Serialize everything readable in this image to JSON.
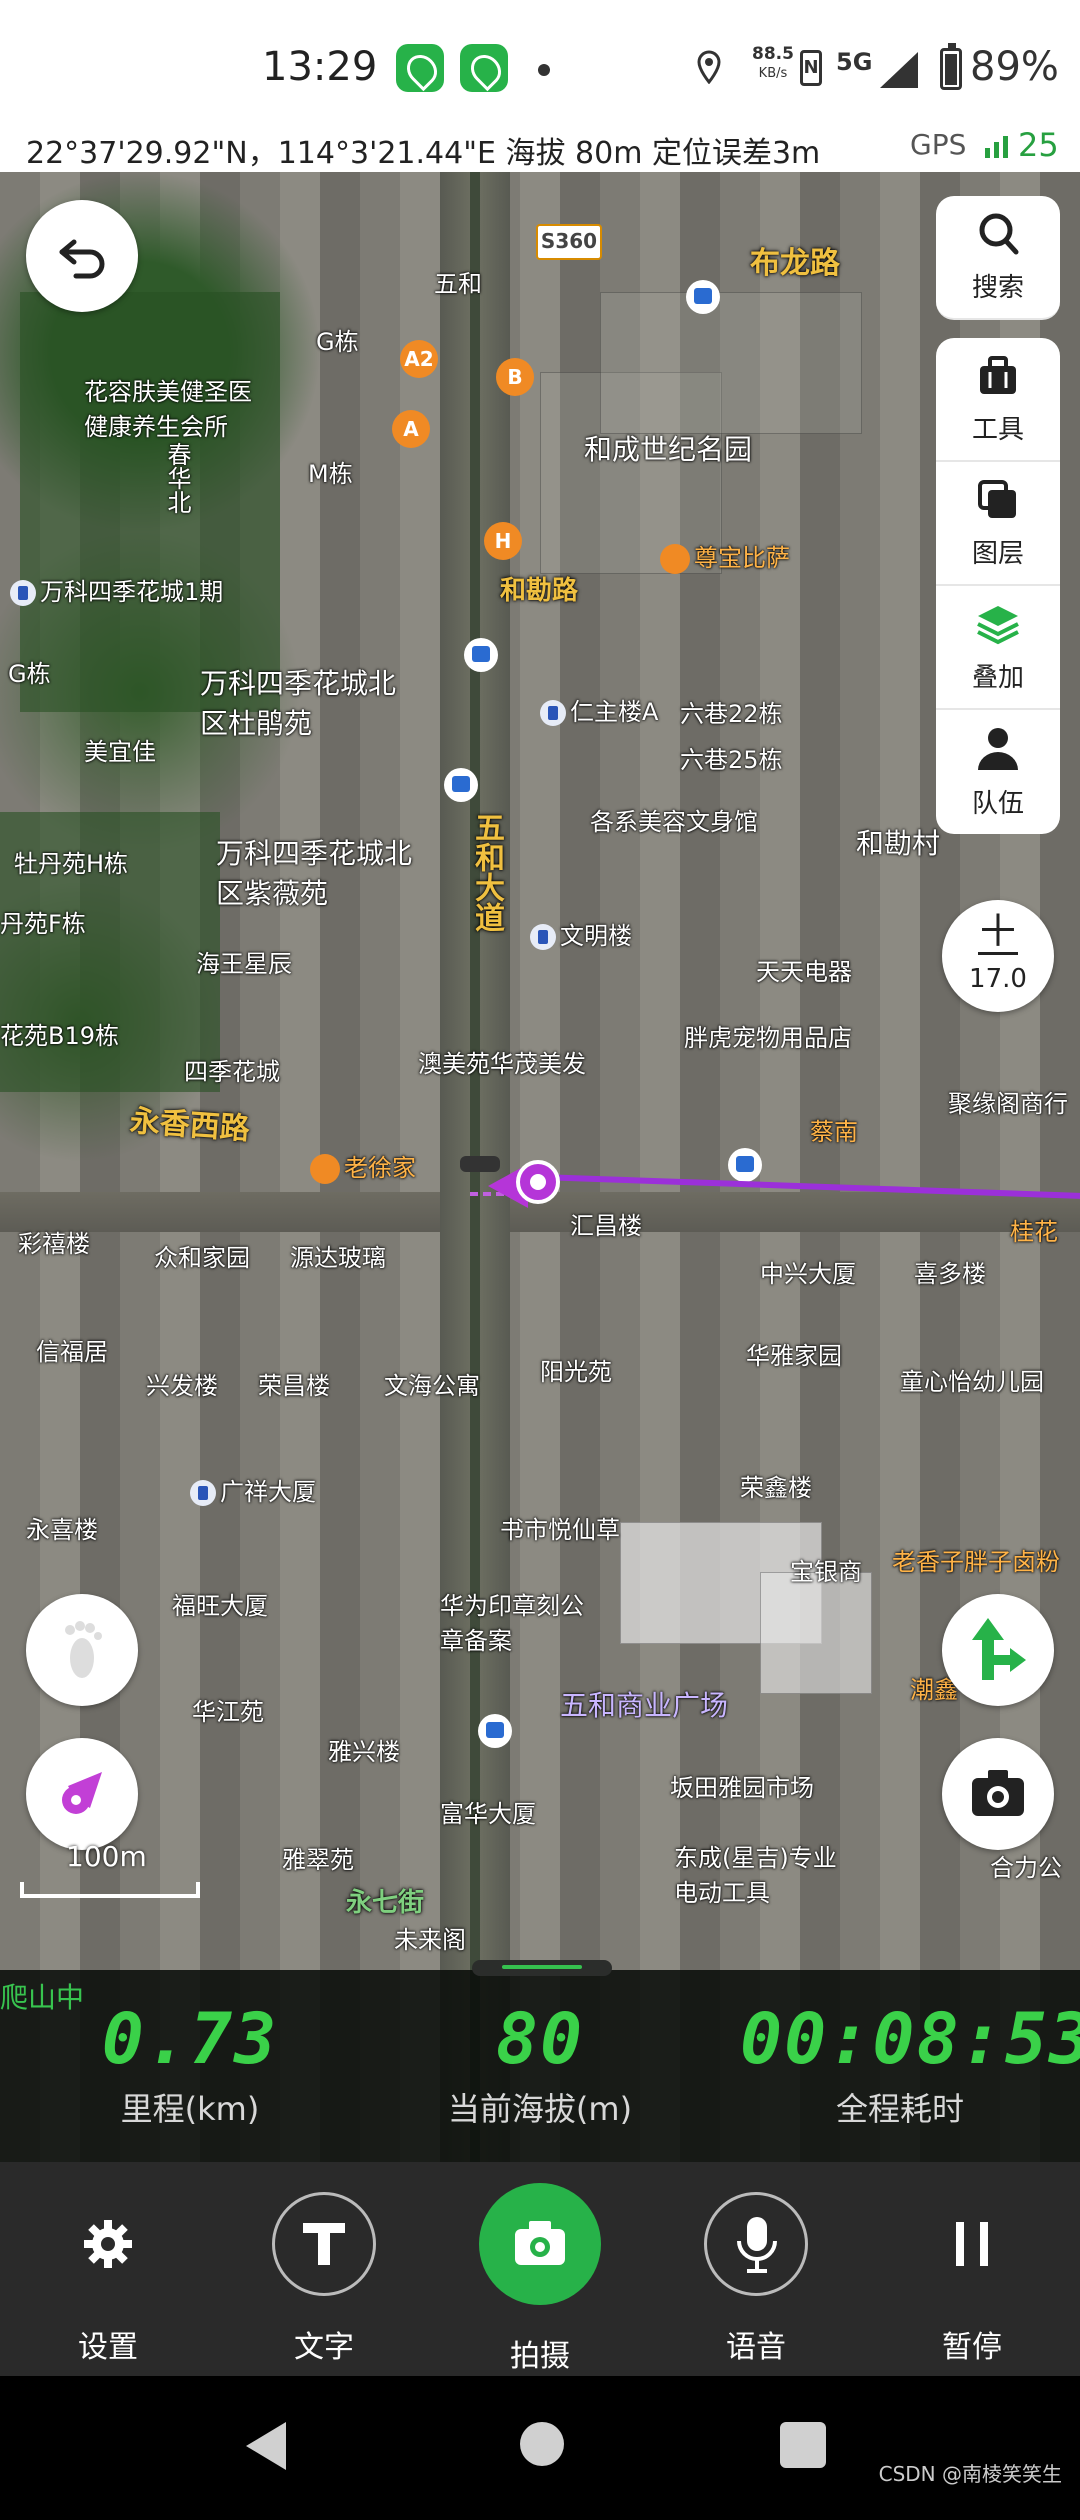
{
  "status_bar": {
    "time": "13:29",
    "network_speed_value": "88.5",
    "network_speed_unit": "KB/s",
    "network_type": "5G",
    "battery": "89%"
  },
  "location_bar": {
    "coordinates": "22°37'29.92\"N，114°3'21.44\"E  海拔 80m  定位误差3m",
    "gps_label": "GPS",
    "satellite_count": "25"
  },
  "map": {
    "route_shield": "S360",
    "road_labels": [
      "布龙路",
      "五和大道",
      "永香西路",
      "和勘路",
      "永七街"
    ],
    "pois": [
      "五和",
      "G栋",
      "花容肤美健圣医健康养生会所",
      "春华北",
      "和成世纪名园",
      "M栋",
      "尊宝比萨",
      "万科四季花城1期",
      "美宜佳",
      "G栋",
      "万科四季花城北区杜鹃苑",
      "仁主楼A",
      "六巷22栋",
      "六巷25栋",
      "各系美容文身馆",
      "和勘村",
      "牡丹苑H栋",
      "丹苑F栋",
      "万科四季花城北区紫薇苑",
      "文明楼",
      "海王星辰",
      "天天电器",
      "花苑B19栋",
      "四季花城",
      "澳美苑华茂美发",
      "胖虎宠物用品店",
      "聚缘阁商行",
      "老徐家",
      "汇昌楼",
      "蔡南",
      "桂花",
      "彩禧楼",
      "众和家园",
      "源达玻璃",
      "中兴大厦",
      "喜多楼",
      "信福居",
      "兴发楼",
      "荣昌楼",
      "文海公寓",
      "阳光苑",
      "华雅家园",
      "童心怡幼儿园",
      "永喜楼",
      "广祥大厦",
      "荣鑫楼",
      "书市悦仙草",
      "老香子胖子卤粉",
      "福旺大厦",
      "华为印章刻公章备案",
      "宝银商",
      "潮鑫",
      "华江苑",
      "雅兴楼",
      "五和商业广场",
      "坂田雅园市场",
      "富华大厦",
      "东成(星吉)专业电动工具",
      "雅翠苑",
      "未来阁",
      "合力公"
    ],
    "exits": [
      "A2",
      "B",
      "A",
      "H"
    ],
    "zoom_level": "17.0",
    "scale_label": "100m"
  },
  "side_panel": {
    "search": "搜索",
    "tools": "工具",
    "layers": "图层",
    "overlay": "叠加",
    "team": "队伍"
  },
  "stats": {
    "status": "爬山中",
    "distance_value": "0.73",
    "distance_label": "里程(km)",
    "altitude_value": "80",
    "altitude_label": "当前海拔(m)",
    "elapsed_value": "00:08:53",
    "elapsed_label": "全程耗时"
  },
  "toolbar": {
    "settings": "设置",
    "text": "文字",
    "photo": "拍摄",
    "voice": "语音",
    "pause": "暂停"
  },
  "watermark": "CSDN @南棱笑笑生",
  "colors": {
    "accent_green": "#27b249",
    "stat_green": "#3ad149",
    "route_purple": "#9b30d9"
  },
  "icons": {
    "back": "back-arrow-icon",
    "search": "search-icon",
    "tools": "toolbox-icon",
    "layers": "layers-icon",
    "overlay": "stack-icon",
    "team": "user-icon",
    "footprint": "footprint-icon",
    "compass": "compass-icon",
    "navigate": "turn-arrow-icon",
    "camera": "camera-icon"
  }
}
